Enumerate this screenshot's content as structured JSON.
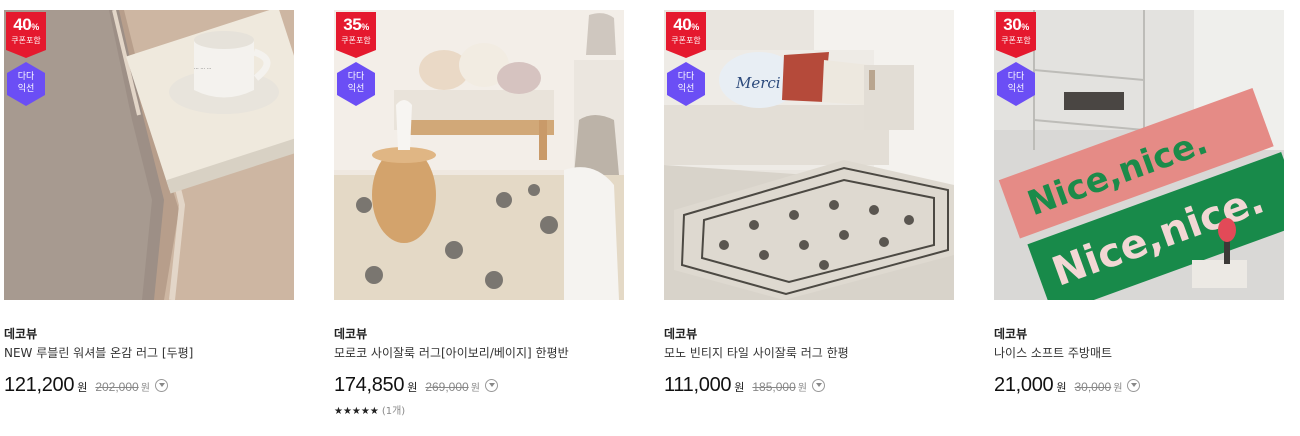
{
  "products": [
    {
      "discount": "40",
      "discount_unit": "%",
      "coupon_label": "쿠폰포함",
      "dada_line1": "다다",
      "dada_line2": "익선",
      "brand": "데코뷰",
      "name": "NEW 루블린 워셔블 온감 러그 [두평]",
      "price": "121,200",
      "price_unit": "원",
      "original_price": "202,000",
      "original_unit": "원"
    },
    {
      "discount": "35",
      "discount_unit": "%",
      "coupon_label": "쿠폰포함",
      "dada_line1": "다다",
      "dada_line2": "익선",
      "brand": "데코뷰",
      "name": "모로코 사이잘룩 러그[아이보리/베이지] 한평반",
      "price": "174,850",
      "price_unit": "원",
      "original_price": "269,000",
      "original_unit": "원",
      "stars": "★★★★★",
      "review_count": "(1개)"
    },
    {
      "discount": "40",
      "discount_unit": "%",
      "coupon_label": "쿠폰포함",
      "dada_line1": "다다",
      "dada_line2": "익선",
      "brand": "데코뷰",
      "name": "모노 빈티지 타일 사이잘룩 러그 한평",
      "price": "111,000",
      "price_unit": "원",
      "original_price": "185,000",
      "original_unit": "원"
    },
    {
      "discount": "30",
      "discount_unit": "%",
      "coupon_label": "쿠폰포함",
      "dada_line1": "다다",
      "dada_line2": "익선",
      "brand": "데코뷰",
      "name": "나이스 소프트 주방매트",
      "price": "21,000",
      "price_unit": "원",
      "original_price": "30,000",
      "original_unit": "원"
    }
  ],
  "image_text": {
    "merci_pillow": "Merci",
    "mat_text": "Nice,nice."
  },
  "colors": {
    "discount_red": "#e5192e",
    "dada_purple": "#6b4ef5"
  }
}
